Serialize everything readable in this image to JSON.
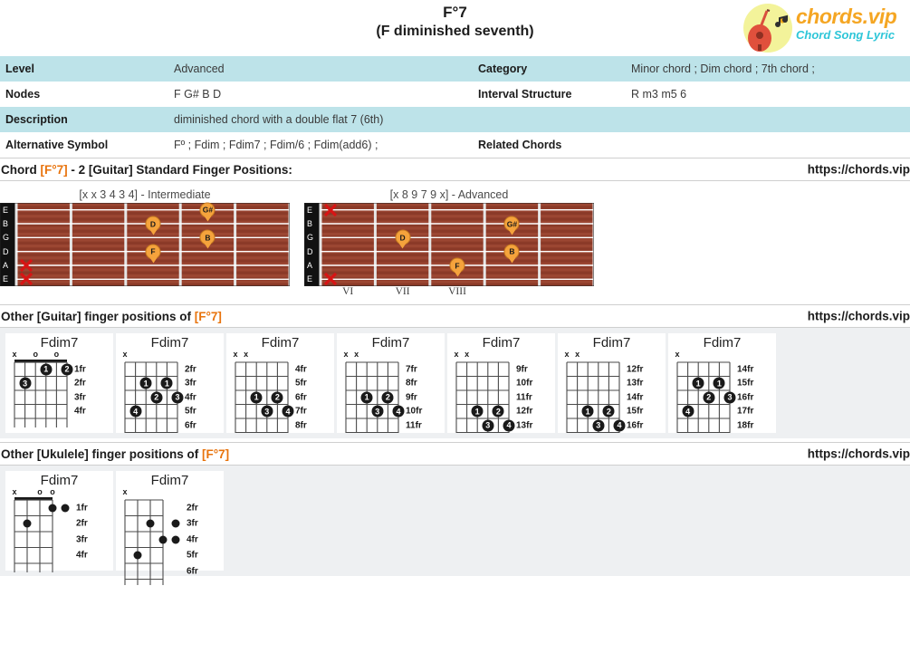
{
  "header": {
    "chord_title": "F°7",
    "chord_subtitle": "(F diminished seventh)",
    "logo_main": "chords.vip",
    "logo_sub": "Chord Song Lyric",
    "logo_icon": "guitar-icon",
    "accent_color": "#e8730c",
    "tint_color": "#bde3e9"
  },
  "info_table": {
    "rows": [
      {
        "label1": "Level",
        "value1": "Advanced",
        "label2": "Category",
        "value2": "Minor chord ; Dim chord ; 7th chord ;",
        "tinted": true
      },
      {
        "label1": "Nodes",
        "value1": "F G# B D",
        "label2": "Interval Structure",
        "value2": "R m3 m5 6",
        "tinted": false
      },
      {
        "label1": "Description",
        "value1": "diminished chord with a double flat 7 (6th)",
        "label2": "",
        "value2": "",
        "tinted": true
      },
      {
        "label1": "Alternative Symbol",
        "value1": "Fº ; Fdim ; Fdim7 ; Fdim/6 ; Fdim(add6) ;",
        "label2": "Related Chords",
        "value2": "",
        "tinted": false
      }
    ]
  },
  "section_standard": {
    "title_prefix": "Chord ",
    "title_chord": "[F°7]",
    "title_suffix": " - 2 [Guitar] Standard Finger Positions:",
    "url": "https://chords.vip"
  },
  "fretboards": [
    {
      "caption": "[x x 3 4 3 4] - Intermediate",
      "strings": [
        "E",
        "B",
        "G",
        "D",
        "A",
        "E"
      ],
      "muted": [
        "A",
        "E"
      ],
      "frets": 5,
      "roman": [],
      "notes": [
        {
          "note": "G#",
          "string": 0,
          "fret": 4
        },
        {
          "note": "D",
          "string": 1,
          "fret": 3
        },
        {
          "note": "B",
          "string": 2,
          "fret": 4
        },
        {
          "note": "F",
          "string": 3,
          "fret": 3
        }
      ]
    },
    {
      "caption": "[x 8 9 7 9 x] - Advanced",
      "strings": [
        "E",
        "B",
        "G",
        "D",
        "A",
        "E"
      ],
      "muted": [
        "E-high",
        "E-low"
      ],
      "frets": 5,
      "roman": [
        "VI",
        "VII",
        "VIII"
      ],
      "notes": [
        {
          "note": "G#",
          "string": 1,
          "fret": 4
        },
        {
          "note": "D",
          "string": 2,
          "fret": 2
        },
        {
          "note": "B",
          "string": 3,
          "fret": 4
        },
        {
          "note": "F",
          "string": 4,
          "fret": 3
        }
      ]
    }
  ],
  "section_guitar": {
    "title_prefix": "Other [Guitar] finger positions of ",
    "title_chord": "[F°7]",
    "url": "https://chords.vip"
  },
  "guitar_boxes": [
    {
      "name": "Fdim7",
      "strings": 6,
      "fret_labels": [
        "1fr",
        "2fr",
        "3fr",
        "4fr"
      ],
      "top_marks": [
        {
          "string": 0,
          "mark": "x"
        },
        {
          "string": 2,
          "mark": "o"
        },
        {
          "string": 4,
          "mark": "o"
        }
      ],
      "nut": true,
      "dots": [
        {
          "string": 3,
          "fret": 1,
          "finger": "1"
        },
        {
          "string": 5,
          "fret": 1,
          "finger": "2"
        },
        {
          "string": 1,
          "fret": 2,
          "finger": "3"
        }
      ]
    },
    {
      "name": "Fdim7",
      "strings": 6,
      "fret_labels": [
        "2fr",
        "3fr",
        "4fr",
        "5fr",
        "6fr"
      ],
      "top_marks": [
        {
          "string": 0,
          "mark": "x"
        }
      ],
      "nut": false,
      "dots": [
        {
          "string": 2,
          "fret": 2,
          "finger": "1"
        },
        {
          "string": 4,
          "fret": 2,
          "finger": "1"
        },
        {
          "string": 3,
          "fret": 3,
          "finger": "2"
        },
        {
          "string": 5,
          "fret": 3,
          "finger": "3"
        },
        {
          "string": 1,
          "fret": 4,
          "finger": "4"
        }
      ]
    },
    {
      "name": "Fdim7",
      "strings": 6,
      "fret_labels": [
        "4fr",
        "5fr",
        "6fr",
        "7fr",
        "8fr"
      ],
      "top_marks": [
        {
          "string": 0,
          "mark": "x"
        },
        {
          "string": 1,
          "mark": "x"
        }
      ],
      "nut": false,
      "dots": [
        {
          "string": 2,
          "fret": 3,
          "finger": "1"
        },
        {
          "string": 4,
          "fret": 3,
          "finger": "2"
        },
        {
          "string": 3,
          "fret": 4,
          "finger": "3"
        },
        {
          "string": 5,
          "fret": 4,
          "finger": "4"
        }
      ]
    },
    {
      "name": "Fdim7",
      "strings": 6,
      "fret_labels": [
        "7fr",
        "8fr",
        "9fr",
        "10fr",
        "11fr"
      ],
      "top_marks": [
        {
          "string": 0,
          "mark": "x"
        },
        {
          "string": 1,
          "mark": "x"
        }
      ],
      "nut": false,
      "dots": [
        {
          "string": 2,
          "fret": 3,
          "finger": "1"
        },
        {
          "string": 4,
          "fret": 3,
          "finger": "2"
        },
        {
          "string": 3,
          "fret": 4,
          "finger": "3"
        },
        {
          "string": 5,
          "fret": 4,
          "finger": "4"
        }
      ]
    },
    {
      "name": "Fdim7",
      "strings": 6,
      "fret_labels": [
        "9fr",
        "10fr",
        "11fr",
        "12fr",
        "13fr"
      ],
      "top_marks": [
        {
          "string": 0,
          "mark": "x"
        },
        {
          "string": 1,
          "mark": "x"
        }
      ],
      "nut": false,
      "dots": [
        {
          "string": 2,
          "fret": 4,
          "finger": "1"
        },
        {
          "string": 4,
          "fret": 4,
          "finger": "2"
        },
        {
          "string": 3,
          "fret": 5,
          "finger": "3"
        },
        {
          "string": 5,
          "fret": 5,
          "finger": "4"
        }
      ]
    },
    {
      "name": "Fdim7",
      "strings": 6,
      "fret_labels": [
        "12fr",
        "13fr",
        "14fr",
        "15fr",
        "16fr"
      ],
      "top_marks": [
        {
          "string": 0,
          "mark": "x"
        },
        {
          "string": 1,
          "mark": "x"
        }
      ],
      "nut": false,
      "dots": [
        {
          "string": 2,
          "fret": 4,
          "finger": "1"
        },
        {
          "string": 4,
          "fret": 4,
          "finger": "2"
        },
        {
          "string": 3,
          "fret": 5,
          "finger": "3"
        },
        {
          "string": 5,
          "fret": 5,
          "finger": "4"
        }
      ]
    },
    {
      "name": "Fdim7",
      "strings": 6,
      "fret_labels": [
        "14fr",
        "15fr",
        "16fr",
        "17fr",
        "18fr"
      ],
      "top_marks": [
        {
          "string": 0,
          "mark": "x"
        }
      ],
      "nut": false,
      "dots": [
        {
          "string": 2,
          "fret": 2,
          "finger": "1"
        },
        {
          "string": 4,
          "fret": 2,
          "finger": "1"
        },
        {
          "string": 3,
          "fret": 3,
          "finger": "2"
        },
        {
          "string": 5,
          "fret": 3,
          "finger": "3"
        },
        {
          "string": 1,
          "fret": 4,
          "finger": "4"
        }
      ]
    }
  ],
  "section_ukulele": {
    "title_prefix": "Other [Ukulele] finger positions of ",
    "title_chord": "[F°7]",
    "url": "https://chords.vip"
  },
  "ukulele_boxes": [
    {
      "name": "Fdim7",
      "strings": 4,
      "fret_labels": [
        "1fr",
        "2fr",
        "3fr",
        "4fr"
      ],
      "top_marks": [
        {
          "string": 0,
          "mark": "x"
        },
        {
          "string": 2,
          "mark": "o"
        },
        {
          "string": 3,
          "mark": "o"
        }
      ],
      "nut": true,
      "dots": [
        {
          "string": 3,
          "fret": 1,
          "finger": ""
        },
        {
          "string": 1,
          "fret": 2,
          "finger": ""
        }
      ],
      "outside_dots": [
        {
          "fret": 1
        }
      ]
    },
    {
      "name": "Fdim7",
      "strings": 4,
      "fret_labels": [
        "2fr",
        "3fr",
        "4fr",
        "5fr",
        "6fr"
      ],
      "top_marks": [
        {
          "string": 0,
          "mark": "x"
        }
      ],
      "nut": false,
      "dots": [
        {
          "string": 2,
          "fret": 2,
          "finger": ""
        },
        {
          "string": 3,
          "fret": 3,
          "finger": ""
        },
        {
          "string": 1,
          "fret": 4,
          "finger": ""
        }
      ],
      "outside_dots": [
        {
          "fret": 2
        },
        {
          "fret": 3
        }
      ]
    }
  ]
}
